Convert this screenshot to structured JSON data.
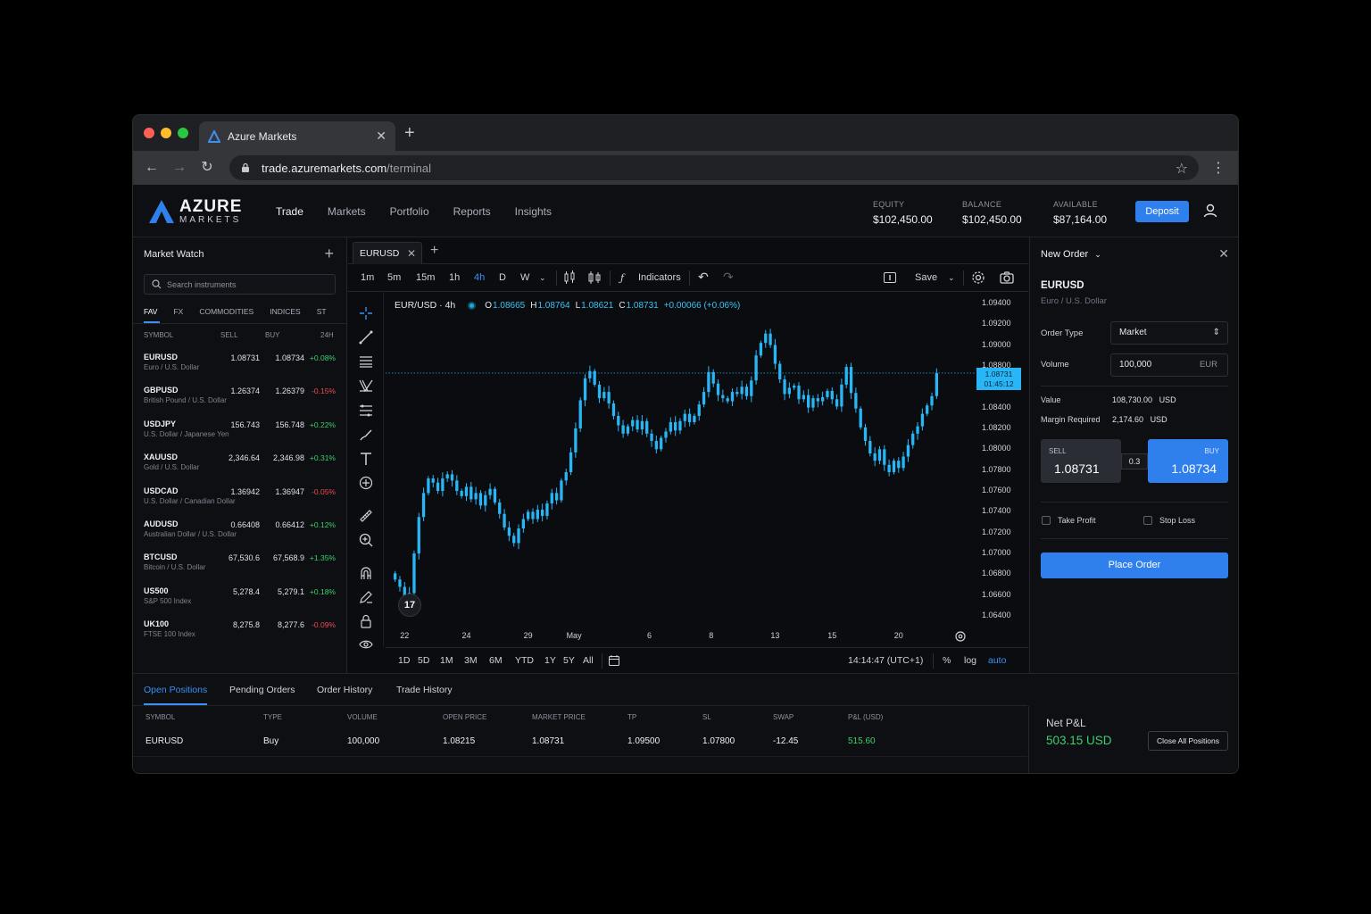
{
  "browser": {
    "tab_title": "Azure Markets",
    "url_host": "trade.azuremarkets.com",
    "url_path": "/terminal"
  },
  "brand": {
    "name": "AZURE",
    "sub": "MARKETS",
    "accent": "#2f80ed"
  },
  "nav": [
    "Trade",
    "Markets",
    "Portfolio",
    "Reports",
    "Insights"
  ],
  "nav_active": "Trade",
  "account": {
    "equity_label": "EQUITY",
    "equity": "$102,450.00",
    "balance_label": "BALANCE",
    "balance": "$102,450.00",
    "available_label": "AVAILABLE",
    "available": "$87,164.00",
    "deposit": "Deposit"
  },
  "market_watch": {
    "title": "Market Watch",
    "search_placeholder": "Search instruments",
    "tabs": [
      "FAV",
      "FX",
      "COMMODITIES",
      "INDICES",
      "ST"
    ],
    "headers": {
      "symbol": "SYMBOL",
      "sell": "SELL",
      "buy": "BUY",
      "change": "24H"
    },
    "rows": [
      {
        "symbol": "EURUSD",
        "desc": "Euro / U.S. Dollar",
        "sell": "1.08731",
        "buy": "1.08734",
        "change": "+0.08%",
        "dir": "up"
      },
      {
        "symbol": "GBPUSD",
        "desc": "British Pound / U.S. Dollar",
        "sell": "1.26374",
        "buy": "1.26379",
        "change": "-0.15%",
        "dir": "down"
      },
      {
        "symbol": "USDJPY",
        "desc": "U.S. Dollar / Japanese Yen",
        "sell": "156.743",
        "buy": "156.748",
        "change": "+0.22%",
        "dir": "up"
      },
      {
        "symbol": "XAUUSD",
        "desc": "Gold / U.S. Dollar",
        "sell": "2,346.64",
        "buy": "2,346.98",
        "change": "+0.31%",
        "dir": "up"
      },
      {
        "symbol": "USDCAD",
        "desc": "U.S. Dollar / Canadian Dollar",
        "sell": "1.36942",
        "buy": "1.36947",
        "change": "-0.05%",
        "dir": "down"
      },
      {
        "symbol": "AUDUSD",
        "desc": "Australian Dollar / U.S. Dollar",
        "sell": "0.66408",
        "buy": "0.66412",
        "change": "+0.12%",
        "dir": "up"
      },
      {
        "symbol": "BTCUSD",
        "desc": "Bitcoin / U.S. Dollar",
        "sell": "67,530.6",
        "buy": "67,568.9",
        "change": "+1.35%",
        "dir": "up"
      },
      {
        "symbol": "US500",
        "desc": "S&P 500 Index",
        "sell": "5,278.4",
        "buy": "5,279.1",
        "change": "+0.18%",
        "dir": "up"
      },
      {
        "symbol": "UK100",
        "desc": "FTSE 100 Index",
        "sell": "8,275.8",
        "buy": "8,277.6",
        "change": "-0.09%",
        "dir": "down"
      }
    ]
  },
  "chart": {
    "tab": "EURUSD",
    "timeframes": [
      "1m",
      "5m",
      "15m",
      "1h",
      "4h",
      "D",
      "W"
    ],
    "active_timeframe": "4h",
    "indicators": "Indicators",
    "save": "Save",
    "title": "EUR/USD · 4h",
    "ohlc": {
      "o_label": "O",
      "o": "1.08665",
      "h_label": "H",
      "h": "1.08764",
      "l_label": "L",
      "l": "1.08621",
      "c_label": "C",
      "c": "1.08731",
      "change": "+0.00066 (+0.06%)"
    },
    "price_tag": "1.08731",
    "countdown": "01:45:12",
    "ranges": [
      "1D",
      "5D",
      "1M",
      "3M",
      "6M",
      "YTD",
      "1Y",
      "5Y",
      "All"
    ],
    "clock": "14:14:47 (UTC+1)",
    "pct": "%",
    "log": "log",
    "auto": "auto",
    "tv_badge": "17",
    "candle_color": "#29b6f6"
  },
  "chart_data": {
    "type": "candlestick",
    "title": "EUR/USD · 4h",
    "y_ticks": [
      "1.09400",
      "1.09200",
      "1.09000",
      "1.08800",
      "1.08600",
      "1.08400",
      "1.08200",
      "1.08000",
      "1.07800",
      "1.07600",
      "1.07400",
      "1.07200",
      "1.07000",
      "1.06800",
      "1.06600",
      "1.06400"
    ],
    "ylim": [
      1.0635,
      1.0945
    ],
    "x_ticks": [
      "22",
      "24",
      "29",
      "May",
      "6",
      "8",
      "13",
      "15",
      "20"
    ],
    "current_price": 1.08731,
    "close_path": [
      1.0675,
      1.0668,
      1.0654,
      1.0662,
      1.07,
      1.0735,
      1.0758,
      1.0772,
      1.0768,
      1.076,
      1.0772,
      1.0776,
      1.077,
      1.076,
      1.0755,
      1.0764,
      1.0752,
      1.0758,
      1.0746,
      1.0756,
      1.0762,
      1.0749,
      1.0738,
      1.0725,
      1.0717,
      1.071,
      1.0724,
      1.0733,
      1.074,
      1.0733,
      1.0742,
      1.0736,
      1.0748,
      1.0758,
      1.0751,
      1.077,
      1.0778,
      1.0797,
      1.082,
      1.0847,
      1.0868,
      1.0875,
      1.0862,
      1.0849,
      1.0855,
      1.0844,
      1.0832,
      1.0823,
      1.0815,
      1.0822,
      1.0828,
      1.0819,
      1.0827,
      1.0815,
      1.0808,
      1.08,
      1.0811,
      1.0817,
      1.0826,
      1.0818,
      1.0827,
      1.0834,
      1.0826,
      1.0832,
      1.0843,
      1.0855,
      1.0874,
      1.0863,
      1.0852,
      1.0849,
      1.0846,
      1.0855,
      1.0853,
      1.086,
      1.0851,
      1.0866,
      1.089,
      1.0902,
      1.0911,
      1.09,
      1.0882,
      1.0867,
      1.0853,
      1.0859,
      1.0861,
      1.0848,
      1.0852,
      1.084,
      1.0849,
      1.0846,
      1.085,
      1.0856,
      1.0848,
      1.0841,
      1.0862,
      1.0879,
      1.0854,
      1.0839,
      1.0821,
      1.0808,
      1.0796,
      1.0789,
      1.08,
      1.0785,
      1.0778,
      1.0789,
      1.0782,
      1.0793,
      1.0804,
      1.0815,
      1.0822,
      1.0834,
      1.0842,
      1.0851,
      1.0873
    ]
  },
  "order": {
    "title": "New Order",
    "symbol": "EURUSD",
    "desc": "Euro / U.S. Dollar",
    "type_label": "Order Type",
    "type": "Market",
    "volume_label": "Volume",
    "volume": "100,000",
    "volume_unit": "EUR",
    "value_label": "Value",
    "value": "108,730.00",
    "value_ccy": "USD",
    "margin_label": "Margin Required",
    "margin": "2,174.60",
    "margin_ccy": "USD",
    "sell_label": "SELL",
    "sell_price": "1.08731",
    "buy_label": "BUY",
    "buy_price": "1.08734",
    "spread": "0.3",
    "tp_label": "Take Profit",
    "sl_label": "Stop Loss",
    "place": "Place Order"
  },
  "bottom": {
    "tabs": [
      "Open Positions",
      "Pending Orders",
      "Order History",
      "Trade History"
    ],
    "headers": [
      "SYMBOL",
      "TYPE",
      "VOLUME",
      "OPEN PRICE",
      "MARKET PRICE",
      "TP",
      "SL",
      "SWAP",
      "P&L (USD)"
    ],
    "row": [
      "EURUSD",
      "Buy",
      "100,000",
      "1.08215",
      "1.08731",
      "1.09500",
      "1.07800",
      "-12.45",
      "515.60"
    ],
    "net_label": "Net P&L",
    "net_value": "503.15 USD",
    "close_all": "Close All Positions"
  }
}
